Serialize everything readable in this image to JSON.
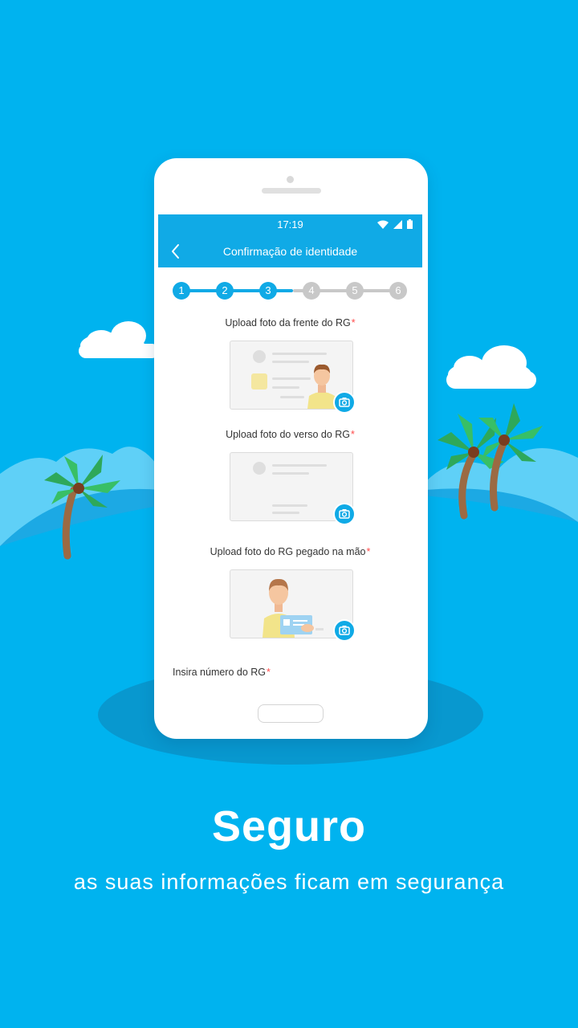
{
  "statusbar": {
    "time": "17:19"
  },
  "appbar": {
    "title": "Confirmação de identidade"
  },
  "stepper": {
    "steps": [
      "1",
      "2",
      "3",
      "4",
      "5",
      "6"
    ],
    "current": 3
  },
  "uploads": {
    "front_label": "Upload foto da frente do RG",
    "back_label": "Upload foto do verso do RG",
    "hand_label": "Upload foto do RG pegado na mão",
    "required_mark": "*"
  },
  "rg_number": {
    "label": "Insira número do RG",
    "required_mark": "*"
  },
  "promo": {
    "title": "Seguro",
    "subtitle": "as suas informações ficam em segurança"
  },
  "colors": {
    "background": "#00b3ef",
    "accent": "#10aae6",
    "inactive": "#c8c8c8",
    "required": "#ff4b4b"
  }
}
